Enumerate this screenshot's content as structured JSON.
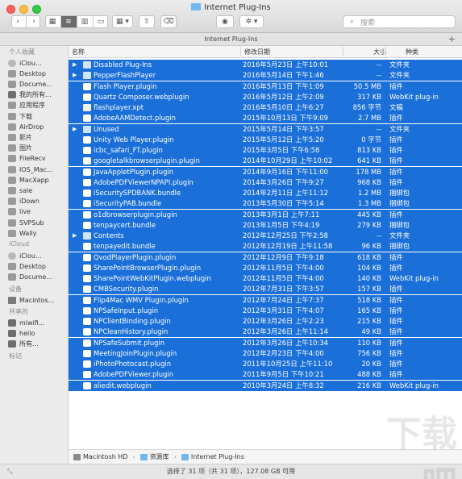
{
  "window": {
    "title": "Internet Plug-Ins"
  },
  "toolbar": {
    "back": "‹",
    "forward": "›",
    "view_icons": "▦",
    "view_list": "≡",
    "view_columns": "▥",
    "view_cover": "▭",
    "arrange": "▦ ▾",
    "share": "⇧",
    "tags": "⌫",
    "eye": "◉",
    "action": "✲ ▾",
    "search_placeholder": "搜索"
  },
  "path_header": {
    "title": "Internet Plug-Ins",
    "plus": "+"
  },
  "sidebar": {
    "sections": [
      {
        "title": "个人收藏",
        "items": [
          "iClou...",
          "Desktop",
          "Docume...",
          "我的所有...",
          "应用程序",
          "下载",
          "AirDrop",
          "影片",
          "图片",
          "FileRecv",
          "IOS_Mac...",
          "MacXapp",
          "sale",
          "iDown",
          "live",
          "SVPSub",
          "Wally"
        ]
      },
      {
        "title": "iCloud",
        "items": [
          "iClou...",
          "Desktop",
          "Docume..."
        ]
      },
      {
        "title": "设备",
        "items": [
          "Macintos..."
        ]
      },
      {
        "title": "共享的",
        "items": [
          "miwifi...",
          "hello",
          "所有..."
        ]
      },
      {
        "title": "标记",
        "items": []
      }
    ]
  },
  "columns": {
    "name": "名称",
    "date": "修改日期",
    "size": "大小",
    "kind": "种类"
  },
  "files": [
    {
      "name": "Disabled Plug-Ins",
      "date": "2016年5月23日 上午10:01",
      "size": "--",
      "kind": "文件夹",
      "icon": "folder",
      "expand": "▶"
    },
    {
      "name": "PepperFlashPlayer",
      "date": "2016年5月14日 下午1:46",
      "size": "--",
      "kind": "文件夹",
      "icon": "folder",
      "expand": "▶"
    },
    {
      "name": "Flash Player.plugin",
      "date": "2016年5月13日 下午1:09",
      "size": "50.5 MB",
      "kind": "插件",
      "icon": "plugin",
      "expand": ""
    },
    {
      "name": "Quartz Composer.webplugin",
      "date": "2016年5月12日 上午2:09",
      "size": "317 KB",
      "kind": "WebKit plug-in",
      "icon": "plugin",
      "expand": ""
    },
    {
      "name": "flashplayer.xpt",
      "date": "2016年5月10日 上午6:27",
      "size": "856 字节",
      "kind": "文稿",
      "icon": "doc",
      "expand": ""
    },
    {
      "name": "AdobeAAMDetect.plugin",
      "date": "2015年10月13日 下午9:09",
      "size": "2.7 MB",
      "kind": "插件",
      "icon": "plugin",
      "expand": ""
    },
    {
      "name": "Unused",
      "date": "2015年5月14日 下午3:57",
      "size": "--",
      "kind": "文件夹",
      "icon": "folder",
      "expand": "▶"
    },
    {
      "name": "Unity Web Player.plugin",
      "date": "2015年5月12日 上午5:20",
      "size": "0 字节",
      "kind": "插件",
      "icon": "plugin",
      "expand": ""
    },
    {
      "name": "icbc_safari_FT.plugin",
      "date": "2015年3月5日 下午6:58",
      "size": "813 KB",
      "kind": "插件",
      "icon": "plugin",
      "expand": ""
    },
    {
      "name": "googletalkbrowserplugin.plugin",
      "date": "2014年10月29日 上午10:02",
      "size": "641 KB",
      "kind": "插件",
      "icon": "plugin",
      "expand": ""
    },
    {
      "name": "JavaAppletPlugin.plugin",
      "date": "2014年9月16日 下午11:00",
      "size": "178 MB",
      "kind": "插件",
      "icon": "plugin",
      "expand": ""
    },
    {
      "name": "AdobePDFViewerNPAPI.plugin",
      "date": "2014年3月26日 下午9:27",
      "size": "968 KB",
      "kind": "插件",
      "icon": "plugin",
      "expand": ""
    },
    {
      "name": "iSecuritySPDBANK.bundle",
      "date": "2014年2月11日 上午11:12",
      "size": "1.2 MB",
      "kind": "捆绑包",
      "icon": "plugin",
      "expand": ""
    },
    {
      "name": "iSecurityPAB.bundle",
      "date": "2013年5月30日 下午5:14",
      "size": "1.3 MB",
      "kind": "捆绑包",
      "icon": "plugin",
      "expand": ""
    },
    {
      "name": "o1dbrowserplugin.plugin",
      "date": "2013年3月1日 上午7:11",
      "size": "445 KB",
      "kind": "插件",
      "icon": "plugin",
      "expand": ""
    },
    {
      "name": "tenpaycert.bundle",
      "date": "2013年1月5日 下午4:19",
      "size": "279 KB",
      "kind": "捆绑包",
      "icon": "plugin",
      "expand": ""
    },
    {
      "name": "Contents",
      "date": "2012年12月25日 下午2:58",
      "size": "--",
      "kind": "文件夹",
      "icon": "folder",
      "expand": "▶"
    },
    {
      "name": "tenpayedit.bundle",
      "date": "2012年12月19日 上午11:58",
      "size": "96 KB",
      "kind": "捆绑包",
      "icon": "plugin",
      "expand": ""
    },
    {
      "name": "QvodPlayerPlugin.plugin",
      "date": "2012年12月9日 下午9:18",
      "size": "618 KB",
      "kind": "插件",
      "icon": "plugin",
      "expand": ""
    },
    {
      "name": "SharePointBrowserPlugin.plugin",
      "date": "2012年11月5日 下午4:00",
      "size": "104 KB",
      "kind": "插件",
      "icon": "plugin",
      "expand": ""
    },
    {
      "name": "SharePointWebKitPlugin.webplugin",
      "date": "2012年11月5日 下午4:00",
      "size": "140 KB",
      "kind": "WebKit plug-in",
      "icon": "plugin",
      "expand": ""
    },
    {
      "name": "CMBSecurity.plugin",
      "date": "2012年7月31日 下午3:57",
      "size": "157 KB",
      "kind": "插件",
      "icon": "plugin",
      "expand": ""
    },
    {
      "name": "Flip4Mac WMV Plugin.plugin",
      "date": "2012年7月24日 上午7:37",
      "size": "518 KB",
      "kind": "插件",
      "icon": "plugin",
      "expand": ""
    },
    {
      "name": "NPSafeInput.plugin",
      "date": "2012年3月31日 下午4:07",
      "size": "165 KB",
      "kind": "插件",
      "icon": "plugin",
      "expand": ""
    },
    {
      "name": "NPClientBinding.plugin",
      "date": "2012年3月26日 上午2:23",
      "size": "215 KB",
      "kind": "插件",
      "icon": "plugin",
      "expand": ""
    },
    {
      "name": "NPCleanHistory.plugin",
      "date": "2012年3月26日 上午11:14",
      "size": "49 KB",
      "kind": "插件",
      "icon": "plugin",
      "expand": ""
    },
    {
      "name": "NPSafeSubmit.plugin",
      "date": "2012年3月26日 上午10:34",
      "size": "110 KB",
      "kind": "插件",
      "icon": "plugin",
      "expand": ""
    },
    {
      "name": "MeetingJoinPlugin.plugin",
      "date": "2012年2月23日 下午4:00",
      "size": "756 KB",
      "kind": "插件",
      "icon": "plugin",
      "expand": ""
    },
    {
      "name": "iPhotoPhotocast.plugin",
      "date": "2011年10月25日 上午11:10",
      "size": "20 KB",
      "kind": "插件",
      "icon": "plugin",
      "expand": ""
    },
    {
      "name": "AdobePDFViewer.plugin",
      "date": "2011年9月5日 下午10:21",
      "size": "488 KB",
      "kind": "插件",
      "icon": "plugin",
      "expand": ""
    },
    {
      "name": "aliedit.webplugin",
      "date": "2010年3月24日 上午8:32",
      "size": "216 KB",
      "kind": "WebKit plug-in",
      "icon": "plugin",
      "expand": ""
    }
  ],
  "pathbar": {
    "crumbs": [
      "Macintosh HD",
      "资源库",
      "Internet Plug-Ins"
    ],
    "separator": "›"
  },
  "status": {
    "text": "选择了 31 项（共 31 项），127.08 GB 可用",
    "resize": "⤡"
  },
  "watermark": "下载吧",
  "colors": {
    "selection": "#1a6fd8",
    "folder": "#6fb7ee"
  }
}
